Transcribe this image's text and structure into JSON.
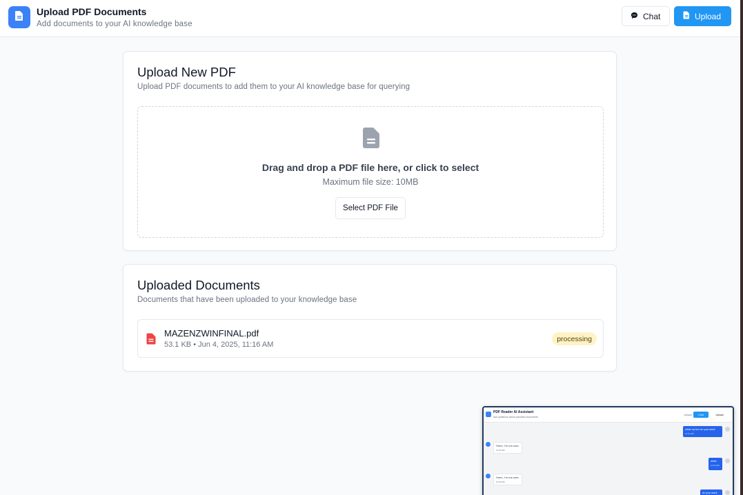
{
  "header": {
    "title": "Upload PDF Documents",
    "subtitle": "Add documents to your AI knowledge base",
    "chat_label": "Chat",
    "upload_label": "Upload"
  },
  "upload_card": {
    "title": "Upload New PDF",
    "description": "Upload PDF documents to add them to your AI knowledge base for querying",
    "drop_text": "Drag and drop a PDF file here, or click to select",
    "max_size_text": "Maximum file size: 10MB",
    "select_button": "Select PDF File"
  },
  "documents_card": {
    "title": "Uploaded Documents",
    "description": "Documents that have been uploaded to your knowledge base",
    "documents": [
      {
        "name": "MAZENZWINFINAL.pdf",
        "meta": "53.1 KB • Jun 4, 2025, 11:16 AM",
        "status": "processing"
      }
    ]
  },
  "preview": {
    "title": "PDF Reader AI Assistant",
    "subtitle": "Ask questions about uploaded documents",
    "nav_upload_link": "Upload",
    "chat_label": "Chat",
    "upload_label": "Upload",
    "messages": [
      {
        "role": "user",
        "text": "what up bro do you work",
        "time": "11:16 AM"
      },
      {
        "role": "ai",
        "text": "Hmm, I'm not sure.",
        "time": "11:16 AM"
      },
      {
        "role": "user",
        "text": "what",
        "time": "11:16 AM"
      },
      {
        "role": "ai",
        "text": "Hmm, I'm not sure.",
        "time": "11:16 AM"
      },
      {
        "role": "user",
        "text": "do you work",
        "time": ""
      }
    ]
  },
  "colors": {
    "accent": "#2196f3",
    "logo": "#3b82f6",
    "pdf_icon": "#ef4444",
    "badge_bg": "#fef3c7"
  }
}
